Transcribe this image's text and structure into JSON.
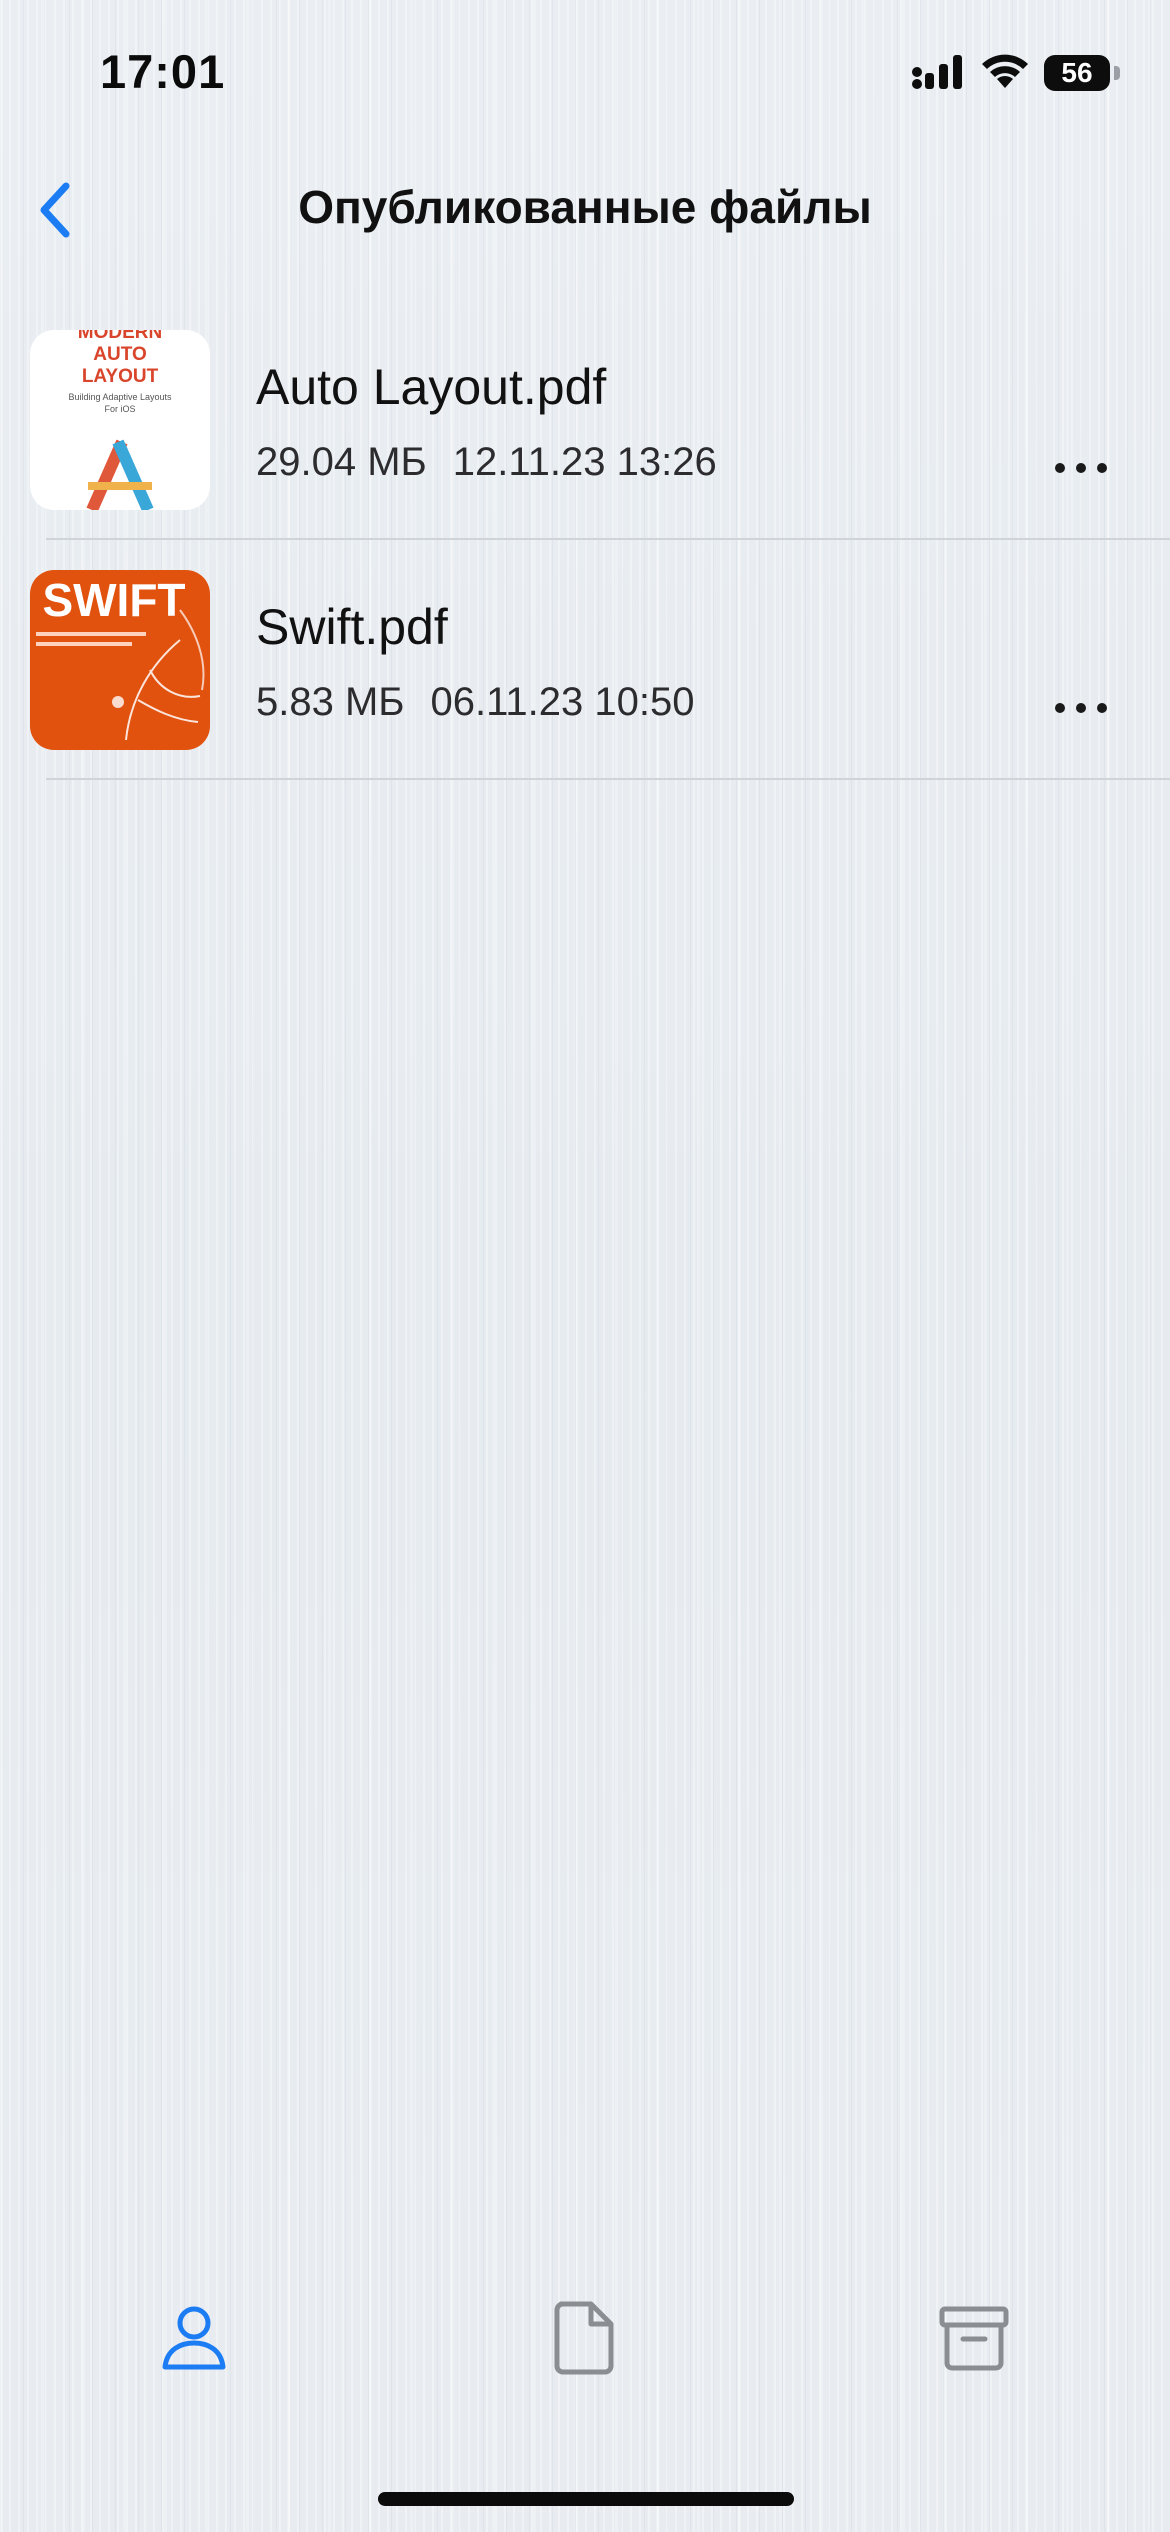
{
  "status_bar": {
    "time": "17:01",
    "battery": "56",
    "icons": [
      "cellular-signal-icon",
      "wifi-icon",
      "battery-icon"
    ]
  },
  "nav": {
    "title": "Опубликованные файлы",
    "back_icon": "chevron-left-icon",
    "accent_color": "#1c7cf4"
  },
  "files": [
    {
      "name": "Auto Layout.pdf",
      "size": "29.04 МБ",
      "date": "12.11.23 13:26",
      "thumb_lines": [
        "MODERN",
        "AUTO",
        "LAYOUT"
      ],
      "thumb_subtitle": "Building Adaptive Layouts",
      "thumb_subtitle2": "For iOS",
      "thumb_colors": {
        "background": "#ffffff",
        "text": "#d9452b",
        "accent": "#3aa7d9"
      }
    },
    {
      "name": "Swift.pdf",
      "size": "5.83 МБ",
      "date": "06.11.23 10:50",
      "thumb_lines": [
        "SWIFT"
      ],
      "thumb_colors": {
        "background": "#e2520f",
        "text": "#ffffff"
      }
    }
  ],
  "tabs": [
    {
      "icon": "person-icon",
      "active": true
    },
    {
      "icon": "document-icon",
      "active": false
    },
    {
      "icon": "archive-box-icon",
      "active": false
    }
  ],
  "colors": {
    "tab_active": "#1c7cf4",
    "tab_inactive": "#8a8e93"
  }
}
